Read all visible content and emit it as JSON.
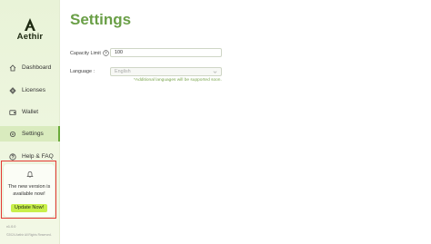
{
  "sidebar": {
    "logo_text": "Aethir",
    "items": [
      {
        "label": "Dashboard",
        "icon": "dashboard-icon"
      },
      {
        "label": "Licenses",
        "icon": "licenses-icon"
      },
      {
        "label": "Wallet",
        "icon": "wallet-icon"
      },
      {
        "label": "Settings",
        "icon": "gear-icon",
        "active": true
      },
      {
        "label": "Help & FAQ",
        "icon": "help-icon"
      }
    ],
    "update_card": {
      "message": "The new version is available now!",
      "button_label": "Update Now!"
    },
    "version": "v1.0.0",
    "copyright": "©2024 Aethir All Rights Reserved."
  },
  "main": {
    "title": "Settings",
    "capacity": {
      "label": "Capacity Limit",
      "value": "100"
    },
    "language": {
      "label": "Language :",
      "value": "English",
      "note": "*Additional languages will be supported soon."
    }
  },
  "colors": {
    "accent": "#6a9f47",
    "button": "#c8ef4a",
    "sidebar_bg": "#eef6df",
    "highlight": "#e53935"
  }
}
